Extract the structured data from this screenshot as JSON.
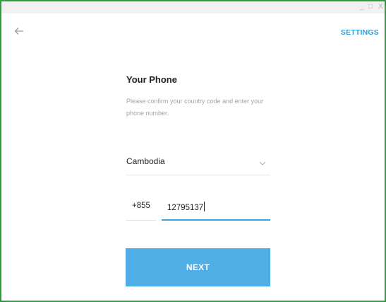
{
  "window": {
    "minimize_glyph": "_",
    "maximize_glyph": "□",
    "close_glyph": "X"
  },
  "header": {
    "settings_label": "SETTINGS"
  },
  "form": {
    "title": "Your Phone",
    "description": "Please confirm your country code and enter your phone number.",
    "country": "Cambodia",
    "country_code": "+855",
    "phone_number": "12795137",
    "next_label": "NEXT"
  },
  "colors": {
    "accent": "#50aee6",
    "link": "#2aa0de",
    "frame_border": "#2e9e3a"
  },
  "icons": {
    "back": "arrow-left-icon",
    "dropdown": "chevron-down-icon"
  }
}
